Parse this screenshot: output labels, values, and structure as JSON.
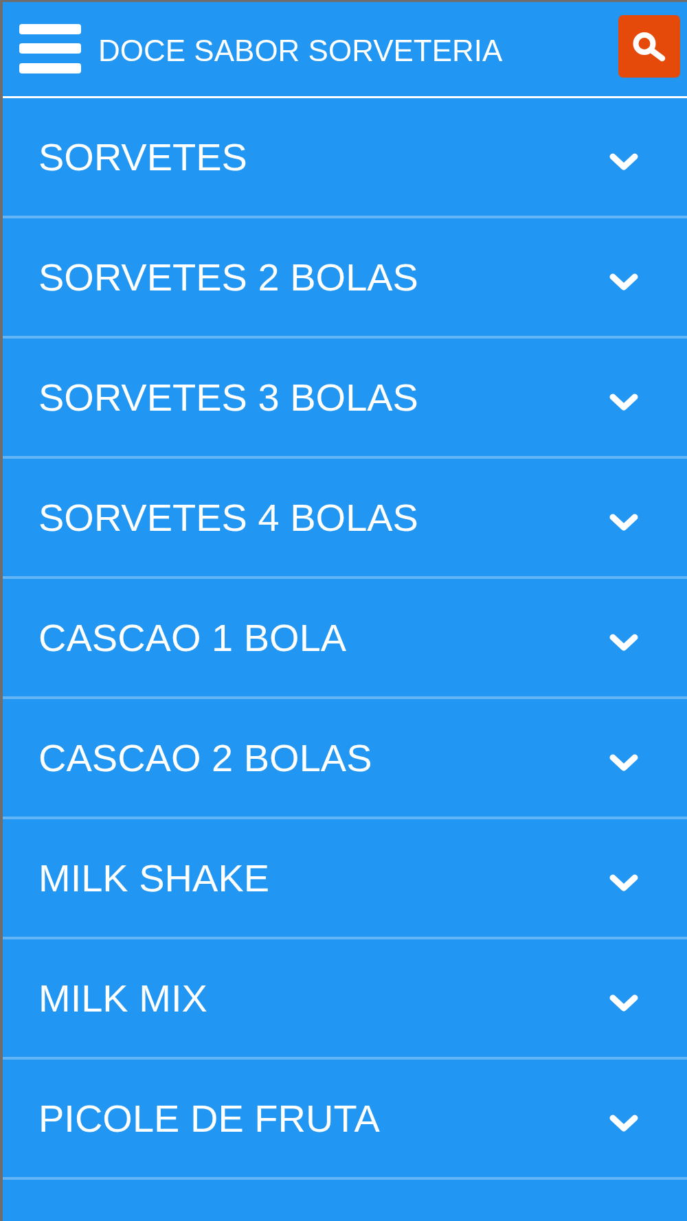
{
  "header": {
    "title": "DOCE SABOR SORVETERIA"
  },
  "categories": [
    {
      "label": "SORVETES",
      "expanded": false
    },
    {
      "label": "SORVETES 2 BOLAS",
      "expanded": false
    },
    {
      "label": "SORVETES 3 BOLAS",
      "expanded": false
    },
    {
      "label": "SORVETES 4 BOLAS",
      "expanded": false
    },
    {
      "label": "CASCAO 1 BOLA",
      "expanded": false
    },
    {
      "label": "CASCAO 2 BOLAS",
      "expanded": false
    },
    {
      "label": "MILK SHAKE",
      "expanded": false
    },
    {
      "label": "MILK MIX",
      "expanded": false
    },
    {
      "label": "PICOLE DE FRUTA",
      "expanded": false
    }
  ]
}
